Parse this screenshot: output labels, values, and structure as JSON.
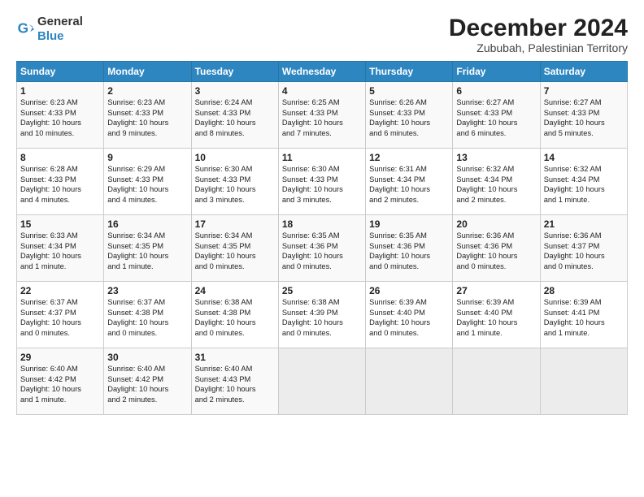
{
  "header": {
    "logo_general": "General",
    "logo_blue": "Blue",
    "month": "December 2024",
    "location": "Zububah, Palestinian Territory"
  },
  "days_of_week": [
    "Sunday",
    "Monday",
    "Tuesday",
    "Wednesday",
    "Thursday",
    "Friday",
    "Saturday"
  ],
  "weeks": [
    [
      {
        "day": 1,
        "lines": [
          "Sunrise: 6:23 AM",
          "Sunset: 4:33 PM",
          "Daylight: 10 hours",
          "and 10 minutes."
        ]
      },
      {
        "day": 2,
        "lines": [
          "Sunrise: 6:23 AM",
          "Sunset: 4:33 PM",
          "Daylight: 10 hours",
          "and 9 minutes."
        ]
      },
      {
        "day": 3,
        "lines": [
          "Sunrise: 6:24 AM",
          "Sunset: 4:33 PM",
          "Daylight: 10 hours",
          "and 8 minutes."
        ]
      },
      {
        "day": 4,
        "lines": [
          "Sunrise: 6:25 AM",
          "Sunset: 4:33 PM",
          "Daylight: 10 hours",
          "and 7 minutes."
        ]
      },
      {
        "day": 5,
        "lines": [
          "Sunrise: 6:26 AM",
          "Sunset: 4:33 PM",
          "Daylight: 10 hours",
          "and 6 minutes."
        ]
      },
      {
        "day": 6,
        "lines": [
          "Sunrise: 6:27 AM",
          "Sunset: 4:33 PM",
          "Daylight: 10 hours",
          "and 6 minutes."
        ]
      },
      {
        "day": 7,
        "lines": [
          "Sunrise: 6:27 AM",
          "Sunset: 4:33 PM",
          "Daylight: 10 hours",
          "and 5 minutes."
        ]
      }
    ],
    [
      {
        "day": 8,
        "lines": [
          "Sunrise: 6:28 AM",
          "Sunset: 4:33 PM",
          "Daylight: 10 hours",
          "and 4 minutes."
        ]
      },
      {
        "day": 9,
        "lines": [
          "Sunrise: 6:29 AM",
          "Sunset: 4:33 PM",
          "Daylight: 10 hours",
          "and 4 minutes."
        ]
      },
      {
        "day": 10,
        "lines": [
          "Sunrise: 6:30 AM",
          "Sunset: 4:33 PM",
          "Daylight: 10 hours",
          "and 3 minutes."
        ]
      },
      {
        "day": 11,
        "lines": [
          "Sunrise: 6:30 AM",
          "Sunset: 4:33 PM",
          "Daylight: 10 hours",
          "and 3 minutes."
        ]
      },
      {
        "day": 12,
        "lines": [
          "Sunrise: 6:31 AM",
          "Sunset: 4:34 PM",
          "Daylight: 10 hours",
          "and 2 minutes."
        ]
      },
      {
        "day": 13,
        "lines": [
          "Sunrise: 6:32 AM",
          "Sunset: 4:34 PM",
          "Daylight: 10 hours",
          "and 2 minutes."
        ]
      },
      {
        "day": 14,
        "lines": [
          "Sunrise: 6:32 AM",
          "Sunset: 4:34 PM",
          "Daylight: 10 hours",
          "and 1 minute."
        ]
      }
    ],
    [
      {
        "day": 15,
        "lines": [
          "Sunrise: 6:33 AM",
          "Sunset: 4:34 PM",
          "Daylight: 10 hours",
          "and 1 minute."
        ]
      },
      {
        "day": 16,
        "lines": [
          "Sunrise: 6:34 AM",
          "Sunset: 4:35 PM",
          "Daylight: 10 hours",
          "and 1 minute."
        ]
      },
      {
        "day": 17,
        "lines": [
          "Sunrise: 6:34 AM",
          "Sunset: 4:35 PM",
          "Daylight: 10 hours",
          "and 0 minutes."
        ]
      },
      {
        "day": 18,
        "lines": [
          "Sunrise: 6:35 AM",
          "Sunset: 4:36 PM",
          "Daylight: 10 hours",
          "and 0 minutes."
        ]
      },
      {
        "day": 19,
        "lines": [
          "Sunrise: 6:35 AM",
          "Sunset: 4:36 PM",
          "Daylight: 10 hours",
          "and 0 minutes."
        ]
      },
      {
        "day": 20,
        "lines": [
          "Sunrise: 6:36 AM",
          "Sunset: 4:36 PM",
          "Daylight: 10 hours",
          "and 0 minutes."
        ]
      },
      {
        "day": 21,
        "lines": [
          "Sunrise: 6:36 AM",
          "Sunset: 4:37 PM",
          "Daylight: 10 hours",
          "and 0 minutes."
        ]
      }
    ],
    [
      {
        "day": 22,
        "lines": [
          "Sunrise: 6:37 AM",
          "Sunset: 4:37 PM",
          "Daylight: 10 hours",
          "and 0 minutes."
        ]
      },
      {
        "day": 23,
        "lines": [
          "Sunrise: 6:37 AM",
          "Sunset: 4:38 PM",
          "Daylight: 10 hours",
          "and 0 minutes."
        ]
      },
      {
        "day": 24,
        "lines": [
          "Sunrise: 6:38 AM",
          "Sunset: 4:38 PM",
          "Daylight: 10 hours",
          "and 0 minutes."
        ]
      },
      {
        "day": 25,
        "lines": [
          "Sunrise: 6:38 AM",
          "Sunset: 4:39 PM",
          "Daylight: 10 hours",
          "and 0 minutes."
        ]
      },
      {
        "day": 26,
        "lines": [
          "Sunrise: 6:39 AM",
          "Sunset: 4:40 PM",
          "Daylight: 10 hours",
          "and 0 minutes."
        ]
      },
      {
        "day": 27,
        "lines": [
          "Sunrise: 6:39 AM",
          "Sunset: 4:40 PM",
          "Daylight: 10 hours",
          "and 1 minute."
        ]
      },
      {
        "day": 28,
        "lines": [
          "Sunrise: 6:39 AM",
          "Sunset: 4:41 PM",
          "Daylight: 10 hours",
          "and 1 minute."
        ]
      }
    ],
    [
      {
        "day": 29,
        "lines": [
          "Sunrise: 6:40 AM",
          "Sunset: 4:42 PM",
          "Daylight: 10 hours",
          "and 1 minute."
        ]
      },
      {
        "day": 30,
        "lines": [
          "Sunrise: 6:40 AM",
          "Sunset: 4:42 PM",
          "Daylight: 10 hours",
          "and 2 minutes."
        ]
      },
      {
        "day": 31,
        "lines": [
          "Sunrise: 6:40 AM",
          "Sunset: 4:43 PM",
          "Daylight: 10 hours",
          "and 2 minutes."
        ]
      },
      null,
      null,
      null,
      null
    ]
  ]
}
